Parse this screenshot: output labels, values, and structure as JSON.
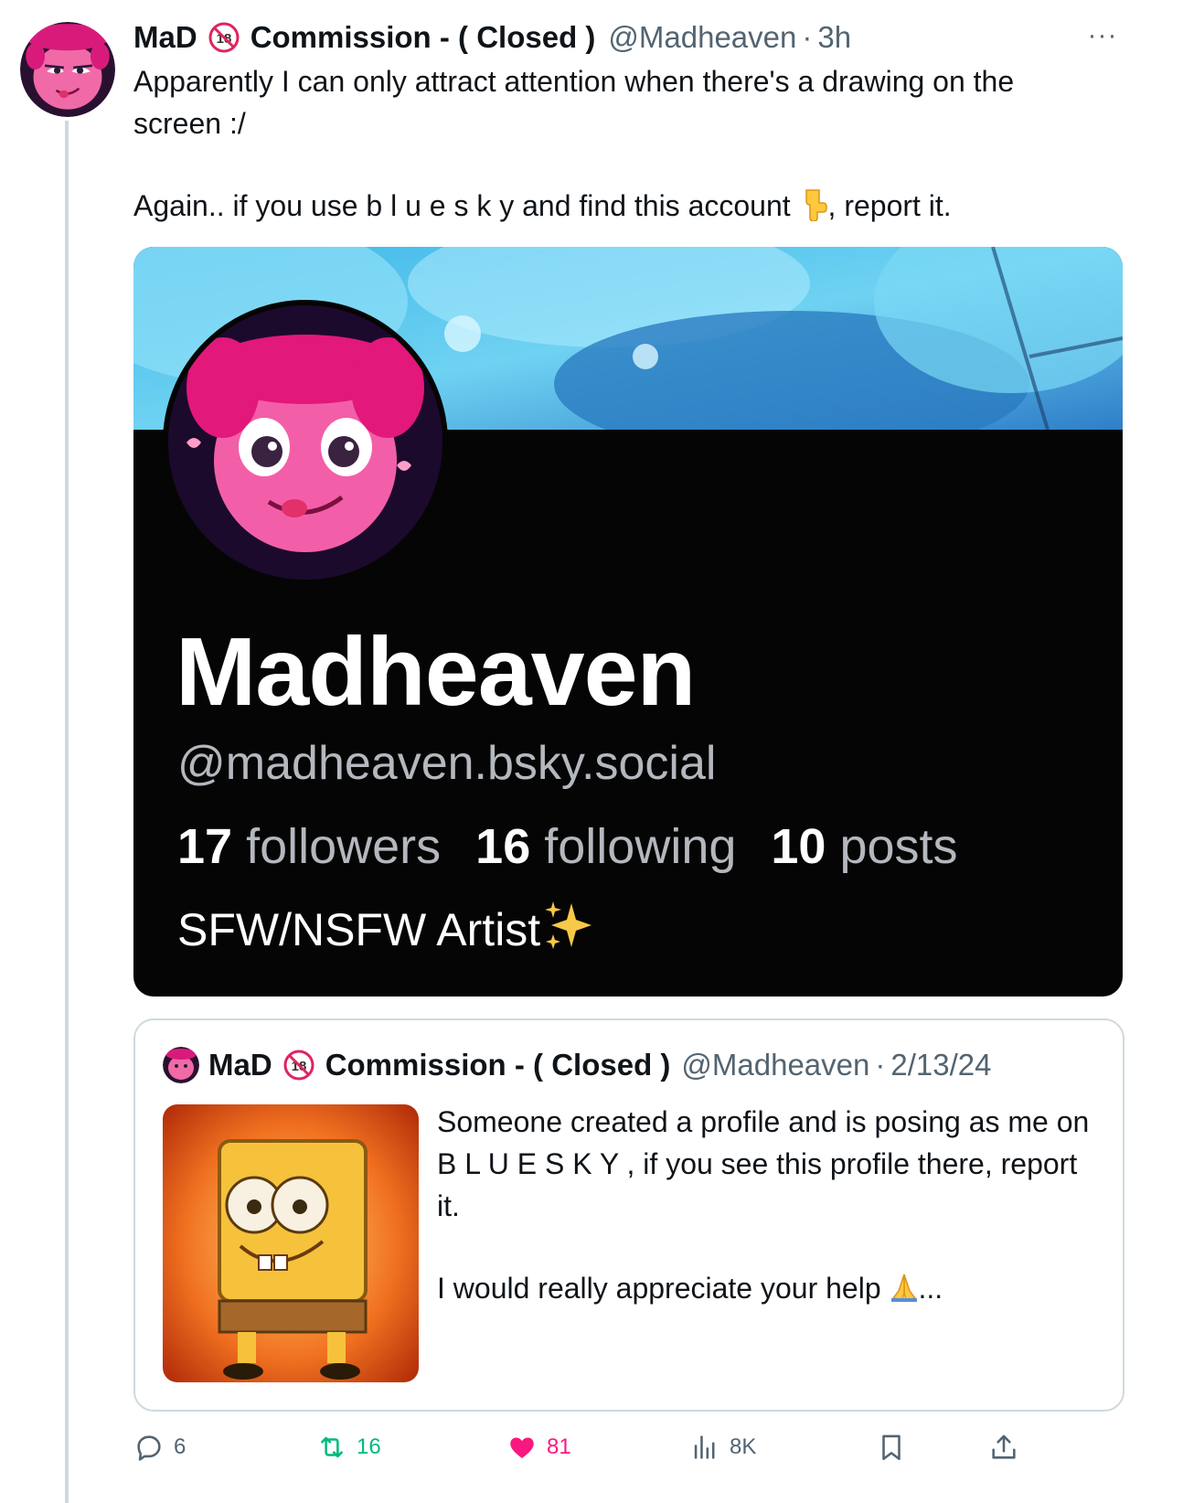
{
  "tweet": {
    "author_name": "MaD",
    "author_name_suffix": "Commission - ( Closed )",
    "handle": "@Madheaven",
    "separator": "·",
    "time": "3h",
    "more_label": "···",
    "text_line1": "Apparently I can only attract attention when there's a drawing on the screen :/",
    "text_line2_before": "Again.. if you use b l u e s k y and find this account",
    "text_line2_after": ", report it."
  },
  "embedded_profile": {
    "display_name": "Madheaven",
    "handle": "@madheaven.bsky.social",
    "followers_count": "17",
    "followers_label": "followers",
    "following_count": "16",
    "following_label": "following",
    "posts_count": "10",
    "posts_label": "posts",
    "bio": "SFW/NSFW Artist"
  },
  "quote": {
    "author_name": "MaD",
    "author_name_suffix": "Commission - ( Closed )",
    "handle": "@Madheaven",
    "separator": "·",
    "date": "2/13/24",
    "text_para1": "Someone created a profile and is posing as me on B L U E S K Y , if you see this profile there, report it.",
    "text_para2_before": "I would really appreciate your help",
    "text_para2_after": "..."
  },
  "actions": {
    "replies": "6",
    "reposts": "16",
    "likes": "81",
    "views": "8K"
  },
  "colors": {
    "repost": "#00ba7c",
    "like": "#f91880",
    "secondary_text": "#536471",
    "divider": "#cfd9de"
  },
  "icons": {
    "reply": "reply-icon",
    "repost": "repost-icon",
    "like": "heart-icon",
    "views": "views-icon",
    "bookmark": "bookmark-icon",
    "share": "share-icon",
    "badge": "18-plus-icon"
  }
}
